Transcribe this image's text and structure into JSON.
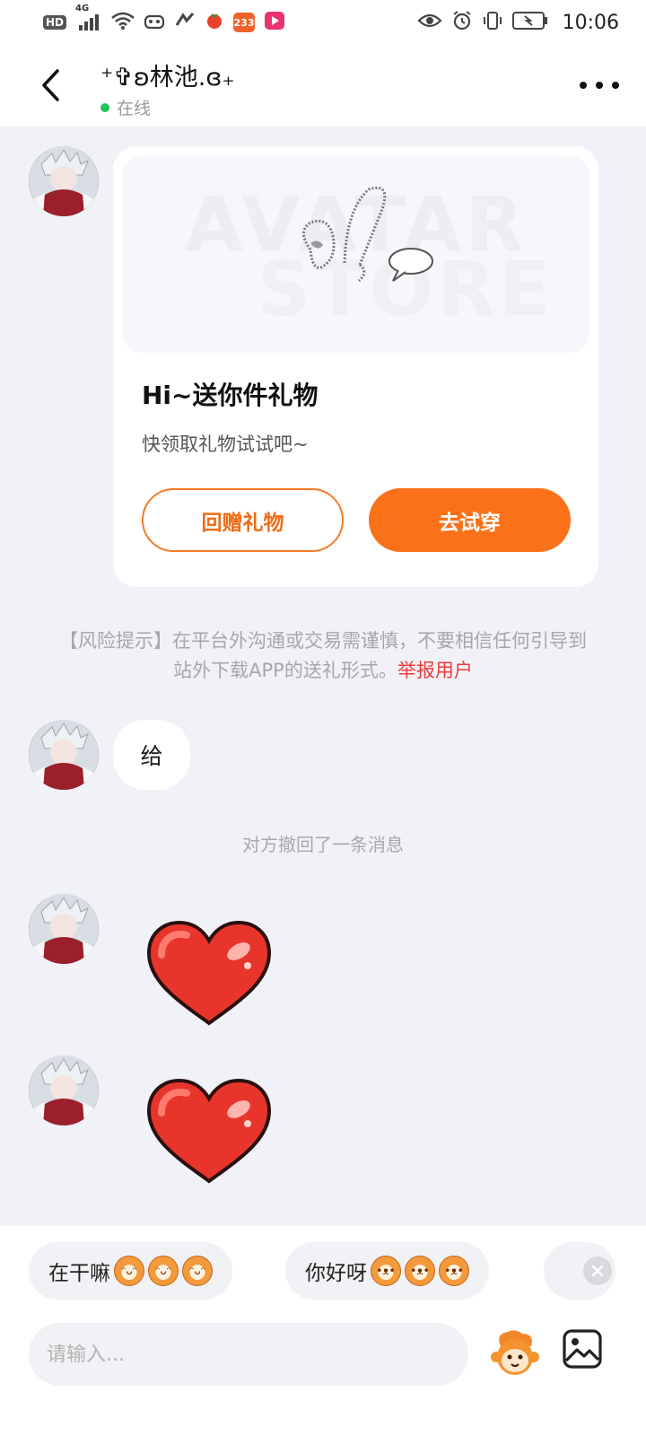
{
  "status_bar": {
    "network_label": "HD",
    "signal_label": "4G",
    "badge_233": "233",
    "time": "10:06",
    "icons": [
      "signal-icon",
      "wifi-icon",
      "game-icon",
      "app-icon",
      "tomato-icon",
      "video-app-icon",
      "eye-icon",
      "alarm-icon",
      "vibrate-icon",
      "battery-icon"
    ]
  },
  "header": {
    "title": "⁺✞ʚ林池.ɞ₊",
    "status": "在线"
  },
  "gift_card": {
    "banner_text_line1": "AVATAR",
    "banner_text_line2": "STORE",
    "title": "Hi~送你件礼物",
    "subtitle": "快领取礼物试试吧~",
    "return_gift_label": "回赠礼物",
    "try_on_label": "去试穿"
  },
  "risk_notice": {
    "text": "【风险提示】在平台外沟通或交易需谨慎，不要相信任何引导到站外下载APP的送礼形式。",
    "report_link": "举报用户"
  },
  "messages": [
    {
      "type": "text",
      "text": "给"
    },
    {
      "type": "system",
      "text": "对方撤回了一条消息"
    },
    {
      "type": "sticker",
      "name": "heart-sticker"
    },
    {
      "type": "sticker",
      "name": "heart-sticker"
    }
  ],
  "quick_replies": [
    {
      "text": "在干嘛"
    },
    {
      "text": "你好呀"
    }
  ],
  "composer": {
    "placeholder": "请输入..."
  },
  "colors": {
    "accent": "#fa7119",
    "online": "#22c35b",
    "report": "#ef3a3a"
  }
}
